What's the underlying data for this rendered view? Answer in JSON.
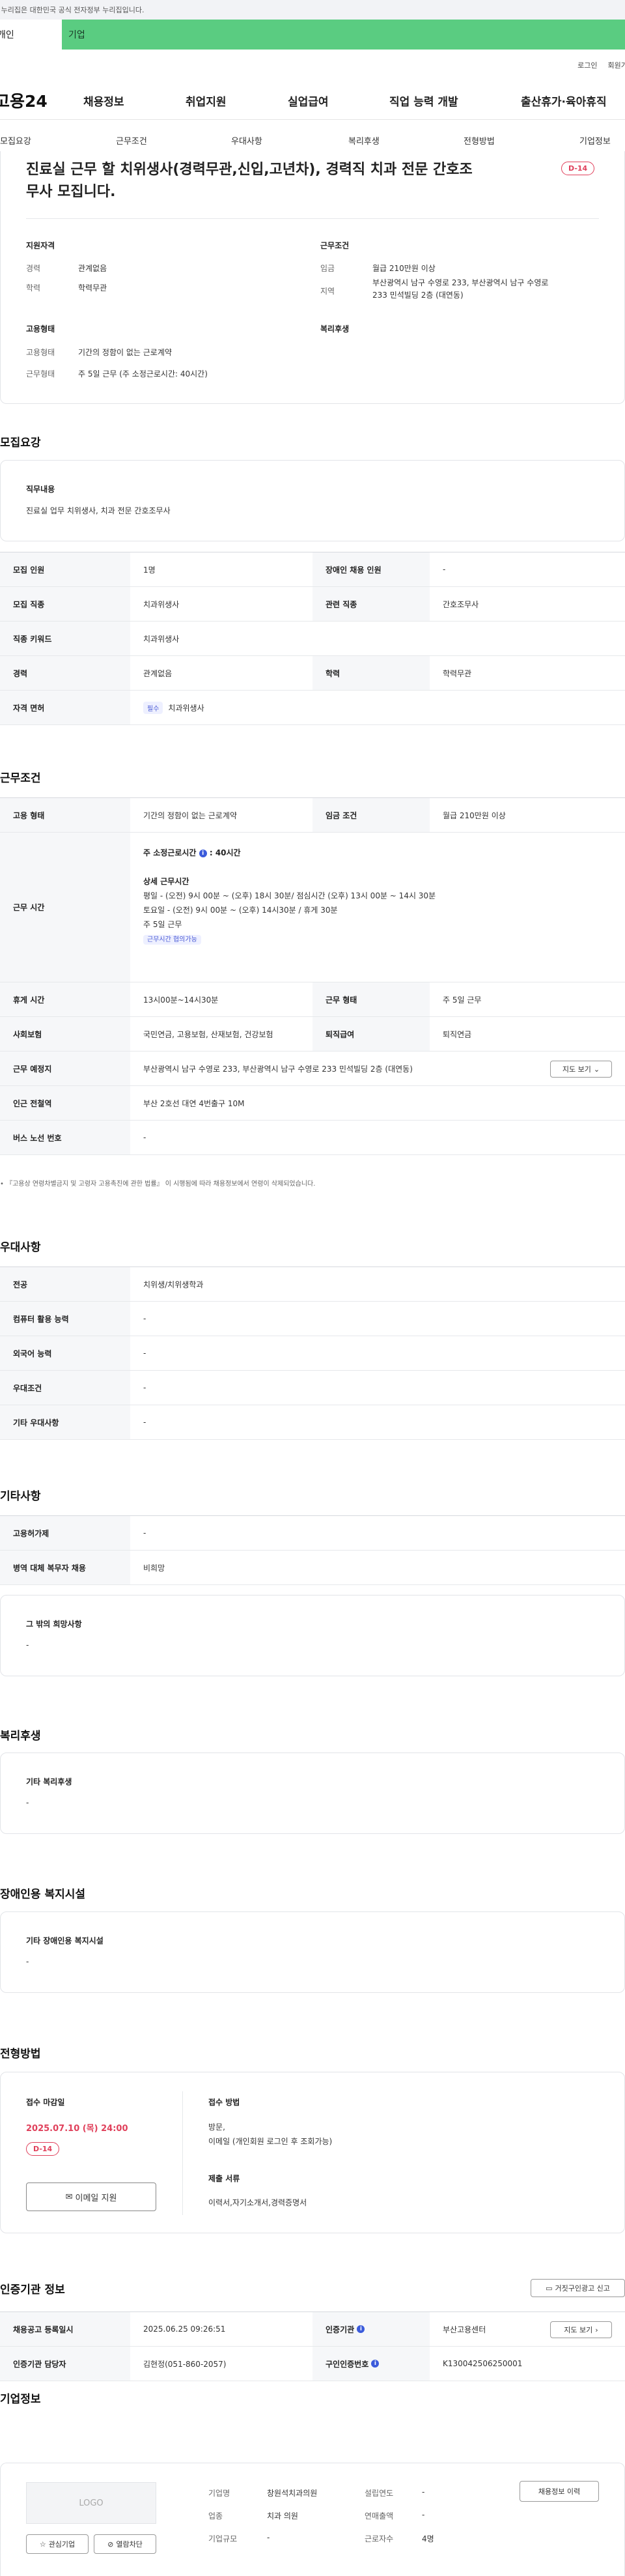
{
  "gov_banner": "이 누리집은 대한민국 공식 전자정부 누리집입니다.",
  "tabs": {
    "person": "개인",
    "biz": "기업"
  },
  "util": {
    "login": "로그인",
    "signup": "회원가입"
  },
  "logo": "고용24",
  "gnb": [
    "채용정보",
    "취업지원",
    "실업급여",
    "직업 능력 개발",
    "출산휴가·육아휴직"
  ],
  "subnav": [
    "모집요강",
    "근무조건",
    "우대사항",
    "복리후생",
    "전형방법",
    "기업정보"
  ],
  "summary": {
    "title_line1": "진료실 근무 할 치위생사(경력무관,신입,고년차), 경력직 치과 전문 간호조",
    "title_line2": "무사 모집니다.",
    "dday": "D-14",
    "qual_heading": "지원자격",
    "career_label": "경력",
    "career_value": "관계없음",
    "edu_label": "학력",
    "edu_value": "학력무관",
    "cond_heading": "근무조건",
    "wage_label": "임금",
    "wage_value": "월급 210만원 이상",
    "region_label": "지역",
    "region_value1": "부산광역시 남구 수영로 233, 부산광역시 남구 수영로",
    "region_value2": "233 민석빌딩 2층 (대연동)",
    "emp_heading": "고용형태",
    "emptype_label": "고용형태",
    "emptype_value": "기간의 정함이 없는 근로계약",
    "worktype_label": "근무형태",
    "worktype_value": "주 5일 근무 (주 소정근로시간: 40시간)",
    "welfare_heading": "복리후생"
  },
  "recruit": {
    "title": "모집요강",
    "duty_heading": "직무내용",
    "duty_text": "진료실 업무 치위생사, 치과 전문 간호조무사",
    "rows": [
      {
        "h1": "모집 인원",
        "v1": "1명",
        "h2": "장애인 채용 인원",
        "v2": "-"
      },
      {
        "h1": "모집 직종",
        "v1": "치과위생사",
        "h2": "관련 직종",
        "v2": "간호조무사"
      },
      {
        "h1": "직종 키워드",
        "v1": "치과위생사"
      },
      {
        "h1": "경력",
        "v1": "관계없음",
        "h2": "학력",
        "v2": "학력무관"
      },
      {
        "h1": "자격 면허",
        "chip": "필수",
        "v1": "치과위생사"
      }
    ]
  },
  "work": {
    "title": "근무조건",
    "emp_h": "고용 형태",
    "emp_v": "기간의 정함이 없는 근로계약",
    "wage_h": "임금 조건",
    "wage_v": "월급 210만원 이상",
    "time_h": "근무 시간",
    "weekly": "주 소정근로시간",
    "weekly_val": ": 40시간",
    "detail_h": "상세 근무시간",
    "detail1": "평일 - (오전) 9시 00분 ~ (오후) 18시 30분/ 점심시간 (오후) 13시 00분 ~ 14시 30분",
    "detail2": "토요일 - (오전) 9시 00분 ~ (오후) 14시30분 / 휴게 30분",
    "detail3": "주 5일 근무",
    "flex_chip": "근무시간 협의가능",
    "rest_h": "휴게 시간",
    "rest_v": "13시00분~14시30분",
    "form_h": "근무 형태",
    "form_v": "주 5일 근무",
    "ins_h": "사회보험",
    "ins_v": "국민연금, 고용보험, 산재보험, 건강보험",
    "retire_h": "퇴직급여",
    "retire_v": "퇴직연금",
    "place_h": "근무 예정지",
    "place_v": "부산광역시 남구 수영로 233, 부산광역시 남구 수영로 233 민석빌딩 2층 (대연동)",
    "map_btn": "지도 보기",
    "subway_h": "인근 전철역",
    "subway_v": "부산 2호선 대연 4번출구 10M",
    "bus_h": "버스 노선 번호",
    "bus_v": "-",
    "note": "『고용상 연령차별금지 및 고령자 고용촉진에 관한 법률』 이 시행됨에 따라 채용정보에서 연령이 삭제되었습니다."
  },
  "pref": {
    "title": "우대사항",
    "rows": [
      {
        "h": "전공",
        "v": "치위생/치위생학과"
      },
      {
        "h": "컴퓨터 활용 능력",
        "v": "-"
      },
      {
        "h": "외국어 능력",
        "v": "-"
      },
      {
        "h": "우대조건",
        "v": "-"
      },
      {
        "h": "기타 우대사항",
        "v": "-"
      }
    ]
  },
  "etc": {
    "title": "기타사항",
    "rows": [
      {
        "h": "고용허가제",
        "v": "-"
      },
      {
        "h": "병역 대체 복무자 채용",
        "v": "비희망"
      }
    ],
    "hope_h": "그 밖의 희망사항",
    "hope_v": "-"
  },
  "welfare": {
    "title": "복리후생",
    "box_h": "기타 복리후생",
    "box_v": "-"
  },
  "disabled": {
    "title": "장애인용 복지시설",
    "box_h": "기타 장애인용 복지시설",
    "box_v": "-"
  },
  "apply": {
    "title": "전형방법",
    "deadline_h": "접수 마감일",
    "deadline_v": "2025.07.10 (목) 24:00",
    "dday": "D-14",
    "email_btn": "이메일 지원",
    "method_h": "접수 방법",
    "method_v1": "방문,",
    "method_v2": "이메일 (개인회원 로그인 후 조회가능)",
    "docs_h": "제출 서류",
    "docs_v": "이력서,자기소개서,경력증명서"
  },
  "agency": {
    "title": "인증기관 정보",
    "report_btn": "거짓구인광고 신고",
    "reg_h": "채용공고 등록일시",
    "reg_v": "2025.06.25 09:26:51",
    "org_h": "인증기관",
    "org_v": "부산고용센터",
    "map_btn": "지도 보기",
    "staff_h": "인증기관 담당자",
    "staff_v": "김현정(051-860-2057)",
    "no_h": "구인인증번호",
    "no_v": "K130042506250001"
  },
  "company": {
    "title": "기업정보",
    "logo_placeholder": "LOGO",
    "fav_btn": "관심기업",
    "block_btn": "열람차단",
    "history_btn": "채용정보 이력",
    "name_h": "기업명",
    "name_v": "창원석치과의원",
    "year_h": "설립연도",
    "year_v": "-",
    "ind_h": "업종",
    "ind_v": "치과 의원",
    "sales_h": "연매출액",
    "sales_v": "-",
    "size_h": "기업규모",
    "size_v": "-",
    "emp_h": "근로자수",
    "emp_v": "4명"
  }
}
